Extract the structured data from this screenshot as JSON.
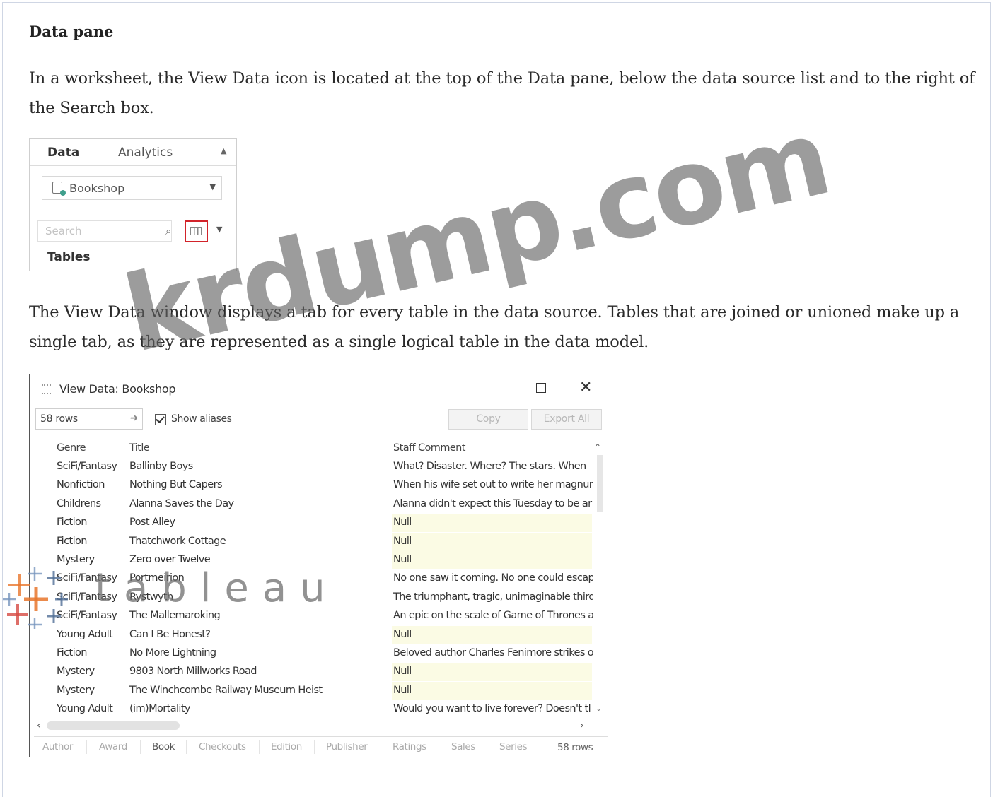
{
  "heading": "Data pane",
  "paragraph1": "In a worksheet, the View Data icon is located at the top of the Data pane, below the data source list and to the right of the Search box.",
  "data_pane": {
    "tab_data": "Data",
    "tab_analytics": "Analytics",
    "data_source": "Bookshop",
    "search_placeholder": "Search",
    "tables_label": "Tables",
    "icons": [
      "datasource-icon",
      "search-icon",
      "view-data-icon",
      "dropdown-icon"
    ]
  },
  "paragraph2": "The View Data window displays a tab for every table in the data source. Tables that are joined or unioned make up a single tab, as they are represented as a single logical table in the data model.",
  "view_data": {
    "title": "View Data:  Bookshop",
    "rows_value": "58 rows",
    "show_aliases": "Show aliases",
    "copy_label": "Copy",
    "export_label": "Export All",
    "columns": [
      "Genre",
      "Title",
      "Staff Comment"
    ],
    "rows": [
      [
        "SciFi/Fantasy",
        "Ballinby Boys",
        "What? Disaster. Where? The stars. When"
      ],
      [
        "Nonfiction",
        "Nothing But Capers",
        "When his wife set out to write her magnur"
      ],
      [
        "Childrens",
        "Alanna Saves the Day",
        "Alanna didn't expect this Tuesday to be ar"
      ],
      [
        "Fiction",
        "Post Alley",
        "Null"
      ],
      [
        "Fiction",
        "Thatchwork Cottage",
        "Null"
      ],
      [
        "Mystery",
        "Zero over Twelve",
        "Null"
      ],
      [
        "SciFi/Fantasy",
        "Portmeirion",
        "No one saw it coming. No one could escap"
      ],
      [
        "SciFi/Fantasy",
        "Rystwyth",
        "The triumphant, tragic, unimaginable third"
      ],
      [
        "SciFi/Fantasy",
        "The Mallemaroking",
        "An epic on the scale of Game of Thrones a"
      ],
      [
        "Young Adult",
        "Can I Be Honest?",
        "Null"
      ],
      [
        "Fiction",
        "No More Lightning",
        "Beloved author Charles Fenimore strikes o"
      ],
      [
        "Mystery",
        "9803 North Millworks Road",
        "Null"
      ],
      [
        "Mystery",
        "The Winchcombe Railway Museum Heist",
        "Null"
      ],
      [
        "Young Adult",
        "(im)Mortality",
        "Would you want to live forever? Doesn't tl"
      ]
    ],
    "tabs": [
      "Author",
      "Award",
      "Book",
      "Checkouts",
      "Edition",
      "Publisher",
      "Ratings",
      "Sales",
      "Series"
    ],
    "active_tab": "Book",
    "footer_rows": "58 rows"
  },
  "watermark": "krdump.com",
  "logo_text": "tableau"
}
